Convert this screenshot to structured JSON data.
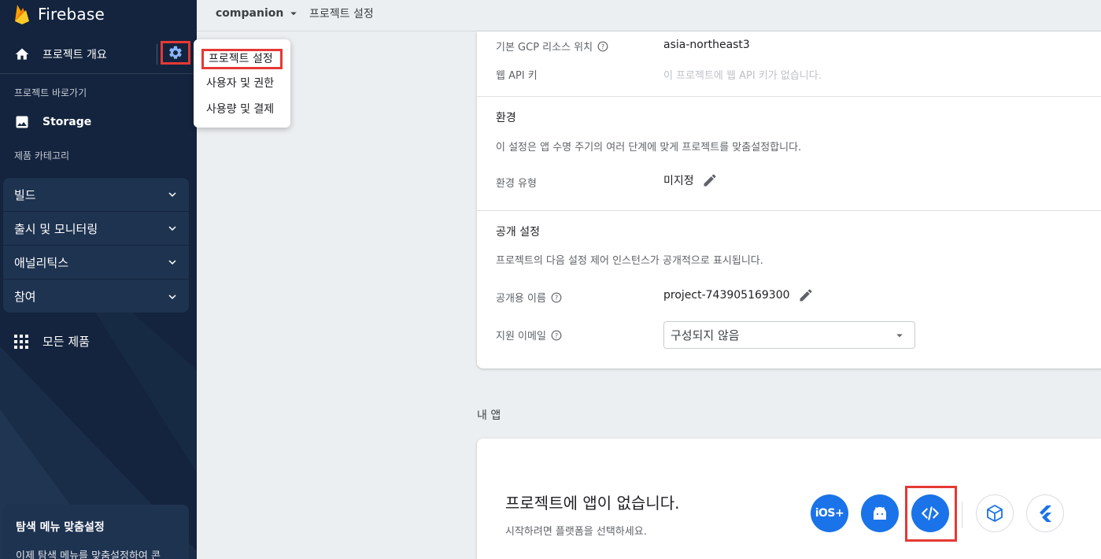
{
  "brand": {
    "name": "Firebase"
  },
  "sidebar": {
    "overview_label": "프로젝트 개요",
    "shortcuts_label": "프로젝트 바로가기",
    "storage_label": "Storage",
    "categories_label": "제품 카테고리",
    "categories": [
      {
        "label": "빌드"
      },
      {
        "label": "출시 및 모니터링"
      },
      {
        "label": "애널리틱스"
      },
      {
        "label": "참여"
      }
    ],
    "all_products_label": "모든 제품",
    "promo": {
      "title": "탐색 메뉴 맞춤설정",
      "text": "이제 탐색 메뉴를 맞춤설정하여 콘"
    }
  },
  "settings_menu": {
    "items": [
      {
        "label": "프로젝트 설정"
      },
      {
        "label": "사용자 및 권한"
      },
      {
        "label": "사용량 및 결제"
      }
    ]
  },
  "topbar": {
    "project_name": "companion",
    "breadcrumb": "프로젝트 설정"
  },
  "settings": {
    "gcp_location_label": "기본 GCP 리소스 위치",
    "gcp_location_value": "asia-northeast3",
    "web_api_key_label": "웹 API 키",
    "web_api_key_value": "이 프로젝트에 웹 API 키가 없습니다.",
    "environment": {
      "heading": "환경",
      "description": "이 설정은 앱 수명 주기의 여러 단계에 맞게 프로젝트를 맞춤설정합니다.",
      "type_label": "환경 유형",
      "type_value": "미지정"
    },
    "public": {
      "heading": "공개 설정",
      "description": "프로젝트의 다음 설정 제어 인스턴스가 공개적으로 표시됩니다.",
      "public_name_label": "공개용 이름",
      "public_name_value": "project-743905169300",
      "support_email_label": "지원 이메일",
      "support_email_value": "구성되지 않음"
    }
  },
  "my_apps": {
    "label": "내 앱",
    "empty_title": "프로젝트에 앱이 없습니다.",
    "empty_subtitle": "시작하려면 플랫폼을 선택하세요.",
    "ios_label": "iOS+",
    "platforms": [
      "ios-icon",
      "android-icon",
      "web-code-icon",
      "unity-icon",
      "flutter-icon"
    ]
  },
  "colors": {
    "sidebar_bg": "#14243e",
    "accent_blue": "#1a73e8",
    "highlight_red": "#e53935",
    "page_bg": "#eceff1"
  }
}
